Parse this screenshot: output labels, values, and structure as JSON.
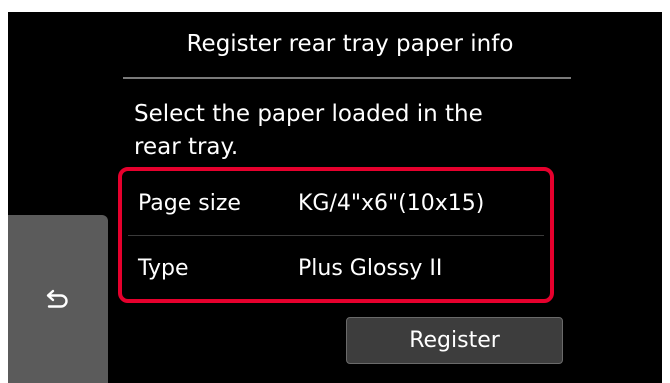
{
  "header": {
    "title": "Register rear tray paper info"
  },
  "message": {
    "text": "Select the paper loaded in the\nrear tray."
  },
  "settings": [
    {
      "label": "Page size",
      "value": "KG/4\"x6\"(10x15)"
    },
    {
      "label": "Type",
      "value": "Plus Glossy II"
    }
  ],
  "buttons": {
    "register_label": "Register",
    "back_icon": "return-arrow-icon"
  },
  "colors": {
    "screen_background": "#000000",
    "highlight_border": "#e6002d",
    "back_button": "#5b5b5b",
    "register_button": "#3d3d3d"
  }
}
